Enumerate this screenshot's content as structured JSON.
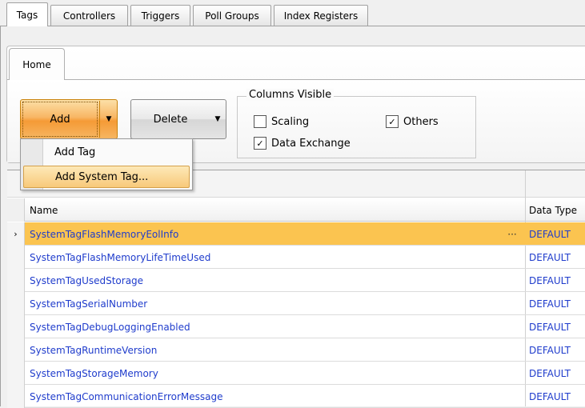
{
  "tabs": [
    "Tags",
    "Controllers",
    "Triggers",
    "Poll Groups",
    "Index Registers"
  ],
  "ribbon": {
    "tab": "Home",
    "add_label": "Add",
    "delete_label": "Delete",
    "columns_group": "Columns Visible",
    "checkboxes": [
      {
        "label": "Scaling",
        "checked": false
      },
      {
        "label": "Others",
        "checked": true
      },
      {
        "label": "Data Exchange",
        "checked": true
      }
    ]
  },
  "menu": {
    "items": [
      "Add Tag",
      "Add System Tag..."
    ],
    "highlighted": 1
  },
  "grid": {
    "columns": [
      "Name",
      "Data Type"
    ],
    "rows": [
      {
        "name": "SystemTagFlashMemoryEolInfo",
        "type": "DEFAULT"
      },
      {
        "name": "SystemTagFlashMemoryLifeTimeUsed",
        "type": "DEFAULT"
      },
      {
        "name": "SystemTagUsedStorage",
        "type": "DEFAULT"
      },
      {
        "name": "SystemTagSerialNumber",
        "type": "DEFAULT"
      },
      {
        "name": "SystemTagDebugLoggingEnabled",
        "type": "DEFAULT"
      },
      {
        "name": "SystemTagRuntimeVersion",
        "type": "DEFAULT"
      },
      {
        "name": "SystemTagStorageMemory",
        "type": "DEFAULT"
      },
      {
        "name": "SystemTagCommunicationErrorMessage",
        "type": "DEFAULT"
      }
    ],
    "selected_row": 0,
    "row_indicator": "›",
    "ellipsis": "···"
  }
}
